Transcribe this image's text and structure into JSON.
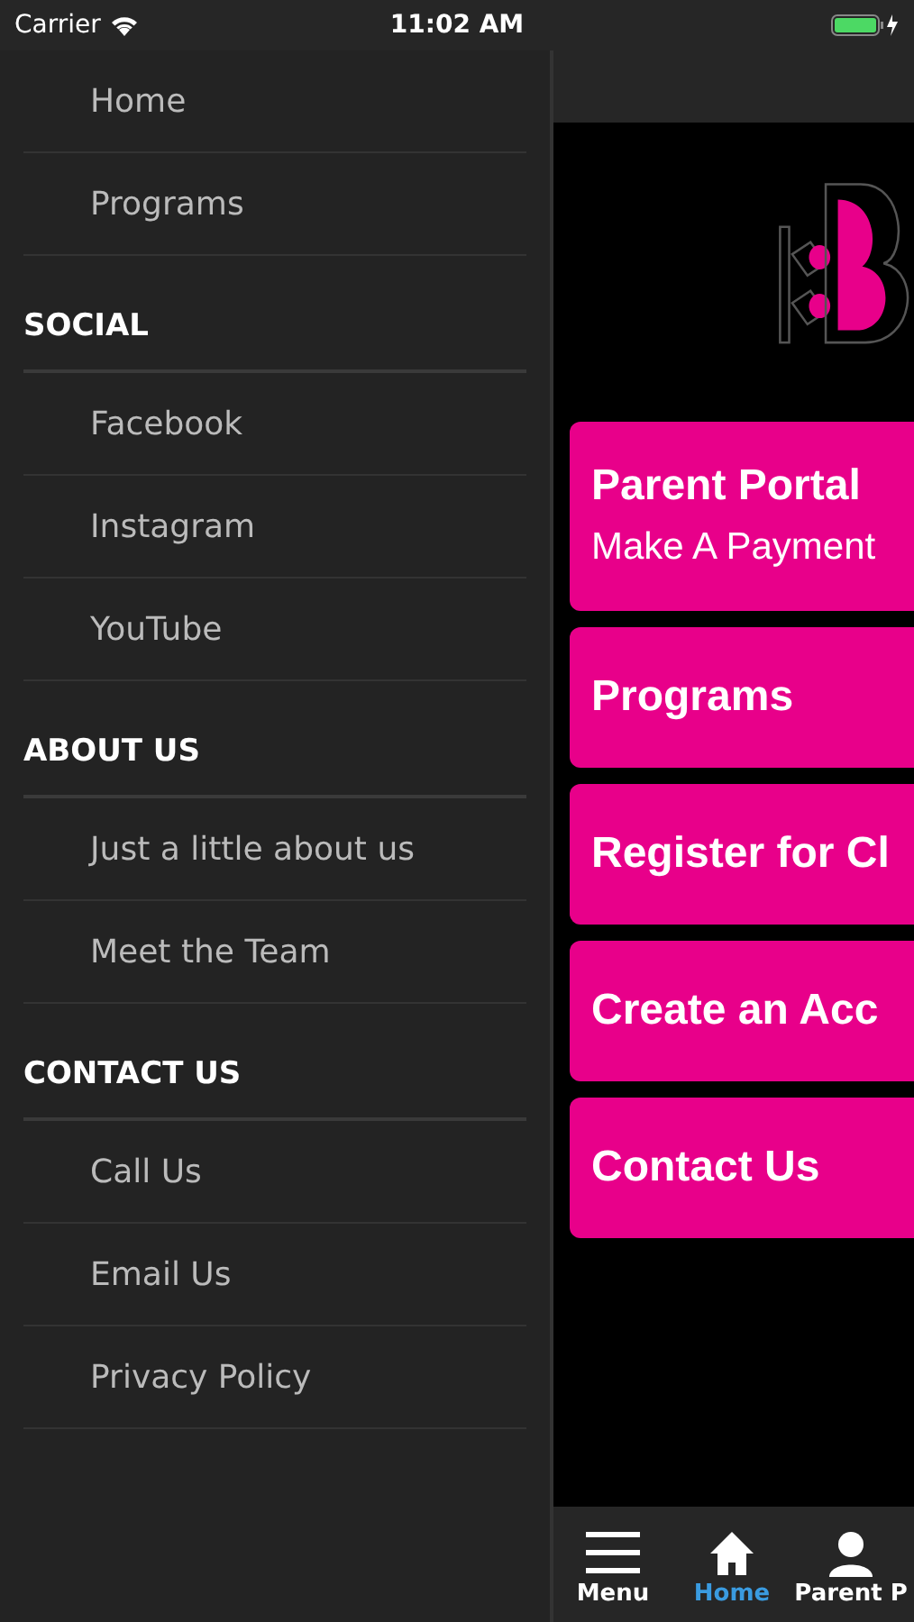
{
  "status_bar": {
    "carrier": "Carrier",
    "time": "11:02 AM"
  },
  "drawer": {
    "sections": [
      {
        "items": [
          "Home",
          "Programs"
        ]
      },
      {
        "title": "SOCIAL",
        "items": [
          "Facebook",
          "Instagram",
          "YouTube"
        ]
      },
      {
        "title": "ABOUT US",
        "items": [
          "Just a little about us",
          "Meet the Team"
        ]
      },
      {
        "title": "CONTACT US",
        "items": [
          "Call Us",
          "Email Us",
          "Privacy Policy"
        ]
      }
    ]
  },
  "main": {
    "cards": [
      {
        "title": "Parent Portal",
        "subtitle": "Make A Payment"
      },
      {
        "title": "Programs"
      },
      {
        "title": "Register for Cl"
      },
      {
        "title": "Create an Acc"
      },
      {
        "title": "Contact Us"
      }
    ]
  },
  "tab_bar": {
    "tabs": [
      {
        "kind": "menu",
        "label": "Menu",
        "selected": false
      },
      {
        "kind": "home",
        "label": "Home",
        "selected": true
      },
      {
        "kind": "person",
        "label": "Parent P",
        "selected": false
      }
    ]
  }
}
